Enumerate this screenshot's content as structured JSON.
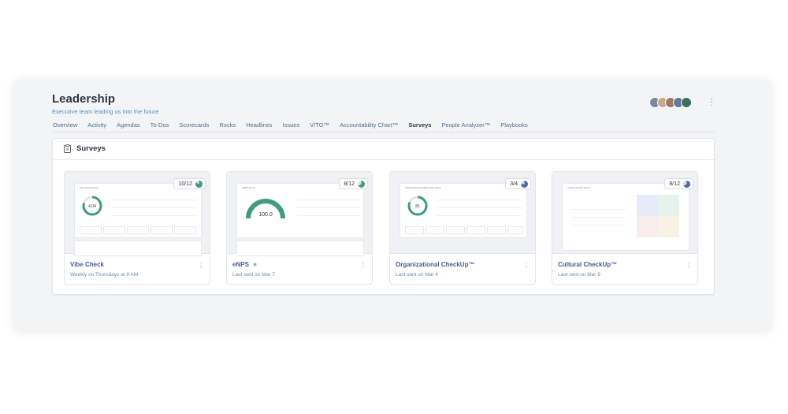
{
  "header": {
    "title": "Leadership",
    "subtitle": "Executive team leading us into the future"
  },
  "avatars": [
    "#7a8899",
    "#c9a88a",
    "#9b7b66",
    "#5d7a9a",
    "#3c6e5a"
  ],
  "tabs": [
    {
      "label": "Overview"
    },
    {
      "label": "Activity"
    },
    {
      "label": "Agendas"
    },
    {
      "label": "To-Dos"
    },
    {
      "label": "Scorecards"
    },
    {
      "label": "Rocks"
    },
    {
      "label": "Headlines"
    },
    {
      "label": "Issues"
    },
    {
      "label": "V/TO™"
    },
    {
      "label": "Accountability Chart™"
    },
    {
      "label": "Surveys"
    },
    {
      "label": "People Analyzer™"
    },
    {
      "label": "Playbooks"
    }
  ],
  "active_tab": "Surveys",
  "surveys_card": {
    "title": "Surveys",
    "items": [
      {
        "name": "Vibe Check",
        "meta": "Weekly on Thursdays at 9 AM",
        "badge": "10/12",
        "pie_color": "#3f9d7a"
      },
      {
        "name": "eNPS",
        "meta": "Last sent on Mar 7",
        "badge": "8/12",
        "pie_color": "#3f9d7a"
      },
      {
        "name": "Organizational CheckUp™",
        "meta": "Last sent on Mar 4",
        "badge": "3/4",
        "pie_color": "#5566aa"
      },
      {
        "name": "Cultural CheckUp™",
        "meta": "Last sent on Mar 8",
        "badge": "8/12",
        "pie_color": "#5566aa"
      }
    ]
  },
  "thumbnails": {
    "vibe": {
      "title": "Vibe Check Score",
      "score": "4.04"
    },
    "enps": {
      "title": "eNPS Score",
      "score": "100.0"
    },
    "org": {
      "title": "Organizational Health Index Score",
      "score": "81"
    },
    "culture": {
      "title": "Cultural Health Score"
    }
  },
  "colors": {
    "accent": "#4a5a9a",
    "green": "#3f9d7a",
    "link": "#5b8cc4"
  }
}
